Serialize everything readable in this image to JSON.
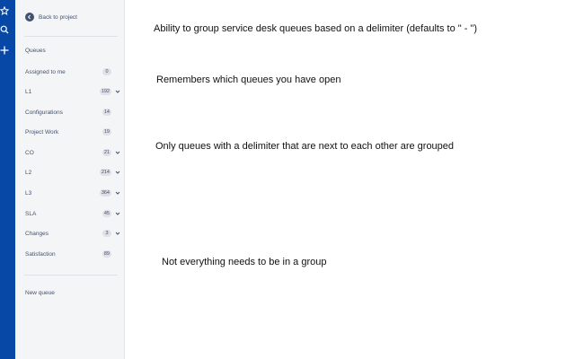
{
  "global_nav": {
    "icons": [
      "star-icon",
      "search-icon",
      "plus-icon"
    ],
    "background": "#0747a6"
  },
  "sidebar": {
    "back_label": "Back to project",
    "section_heading": "Queues",
    "queues": [
      {
        "label": "Assigned to me",
        "count": "0",
        "expandable": false
      },
      {
        "label": "L1",
        "count": "192",
        "expandable": true
      },
      {
        "label": "Configurations",
        "count": "14",
        "expandable": false
      },
      {
        "label": "Project Work",
        "count": "19",
        "expandable": false
      },
      {
        "label": "CO",
        "count": "21",
        "expandable": true
      },
      {
        "label": "L2",
        "count": "214",
        "expandable": true
      },
      {
        "label": "L3",
        "count": "364",
        "expandable": true
      },
      {
        "label": "SLA",
        "count": "45",
        "expandable": true
      },
      {
        "label": "Changes",
        "count": "3",
        "expandable": true
      },
      {
        "label": "Satisfaction",
        "count": "89",
        "expandable": false
      }
    ],
    "new_queue_label": "New queue"
  },
  "captions": [
    "Ability to group service desk queues based on a delimiter (defaults to \" - \")",
    "Remembers which queues you have open",
    "Only queues with a delimiter that are next to each other are grouped",
    "Not everything needs to be in a group"
  ]
}
